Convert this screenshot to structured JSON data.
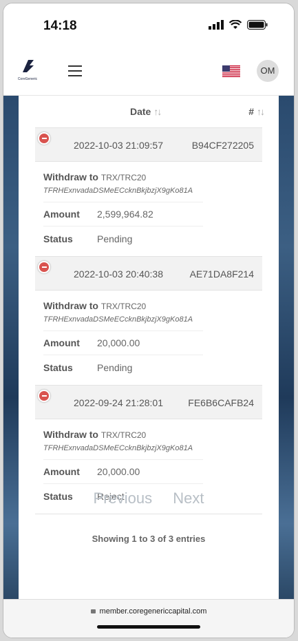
{
  "status_bar": {
    "time": "14:18"
  },
  "navbar": {
    "logo_text": "CoreGeneric",
    "avatar_initials": "OM"
  },
  "table": {
    "header_date": "Date",
    "header_id": "#",
    "rows": [
      {
        "date": "2022-10-03 21:09:57",
        "id": "B94CF272205",
        "withdraw_label": "Withdraw to",
        "network": "TRX/TRC20",
        "address": "TFRHExnvadaDSMeECcknBkjbzjX9gKo81A",
        "amount_label": "Amount",
        "amount": "2,599,964.82",
        "status_label": "Status",
        "status": "Pending"
      },
      {
        "date": "2022-10-03 20:40:38",
        "id": "AE71DA8F214",
        "withdraw_label": "Withdraw to",
        "network": "TRX/TRC20",
        "address": "TFRHExnvadaDSMeECcknBkjbzjX9gKo81A",
        "amount_label": "Amount",
        "amount": "20,000.00",
        "status_label": "Status",
        "status": "Pending"
      },
      {
        "date": "2022-09-24 21:28:01",
        "id": "FE6B6CAFB24",
        "withdraw_label": "Withdraw to",
        "network": "TRX/TRC20",
        "address": "TFRHExnvadaDSMeECcknBkjbzjX9gKo81A",
        "amount_label": "Amount",
        "amount": "20,000.00",
        "status_label": "Status",
        "status": "Reject"
      }
    ],
    "showing_text": "Showing 1 to 3 of 3 entries"
  },
  "pagination": {
    "previous": "Previous",
    "next": "Next"
  },
  "browser": {
    "url": "member.coregenericcapital.com"
  },
  "colors": {
    "expand_icon": "#d9534f",
    "row_header_bg": "#f2f2f2",
    "pager_disabled": "#b8bfc6"
  }
}
